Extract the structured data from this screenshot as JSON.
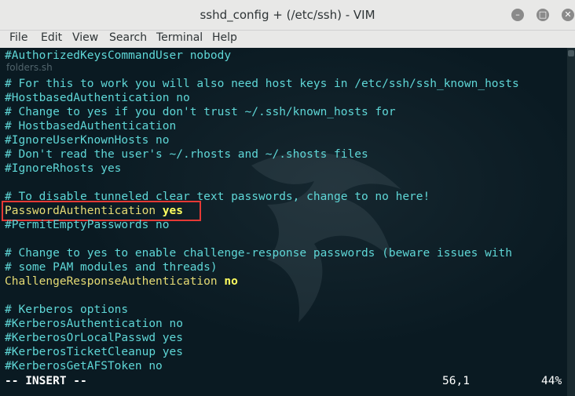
{
  "window": {
    "title": "sshd_config + (/etc/ssh) - VIM"
  },
  "menu": [
    "File",
    "Edit",
    "View",
    "Search",
    "Terminal",
    "Help"
  ],
  "ghost_text": "folders.sh",
  "lines": [
    "#AuthorizedKeysCommandUser nobody",
    "",
    "# For this to work you will also need host keys in /etc/ssh/ssh_known_hosts",
    "#HostbasedAuthentication no",
    "# Change to yes if you don't trust ~/.ssh/known_hosts for",
    "# HostbasedAuthentication",
    "#IgnoreUserKnownHosts no",
    "# Don't read the user's ~/.rhosts and ~/.shosts files",
    "#IgnoreRhosts yes",
    "",
    "# To disable tunneled clear text passwords, change to no here!",
    "",
    "#PermitEmptyPasswords no",
    "",
    "# Change to yes to enable challenge-response passwords (beware issues with",
    "# some PAM modules and threads)",
    "",
    "",
    "# Kerberos options",
    "#KerberosAuthentication no",
    "#KerberosOrLocalPasswd yes",
    "#KerberosTicketCleanup yes",
    "#KerberosGetAFSToken no"
  ],
  "password_auth": {
    "key": "PasswordAuthentication",
    "value": "yes"
  },
  "challenge_auth": {
    "key": "ChallengeResponseAuthentication",
    "value": "no"
  },
  "status": {
    "mode": "-- INSERT --",
    "position": "56,1",
    "percent": "44%"
  },
  "colors": {
    "comment": "#5fd7d7",
    "keyword": "#e6db74",
    "value": "#ffff5f",
    "highlight_box": "#e53935"
  }
}
